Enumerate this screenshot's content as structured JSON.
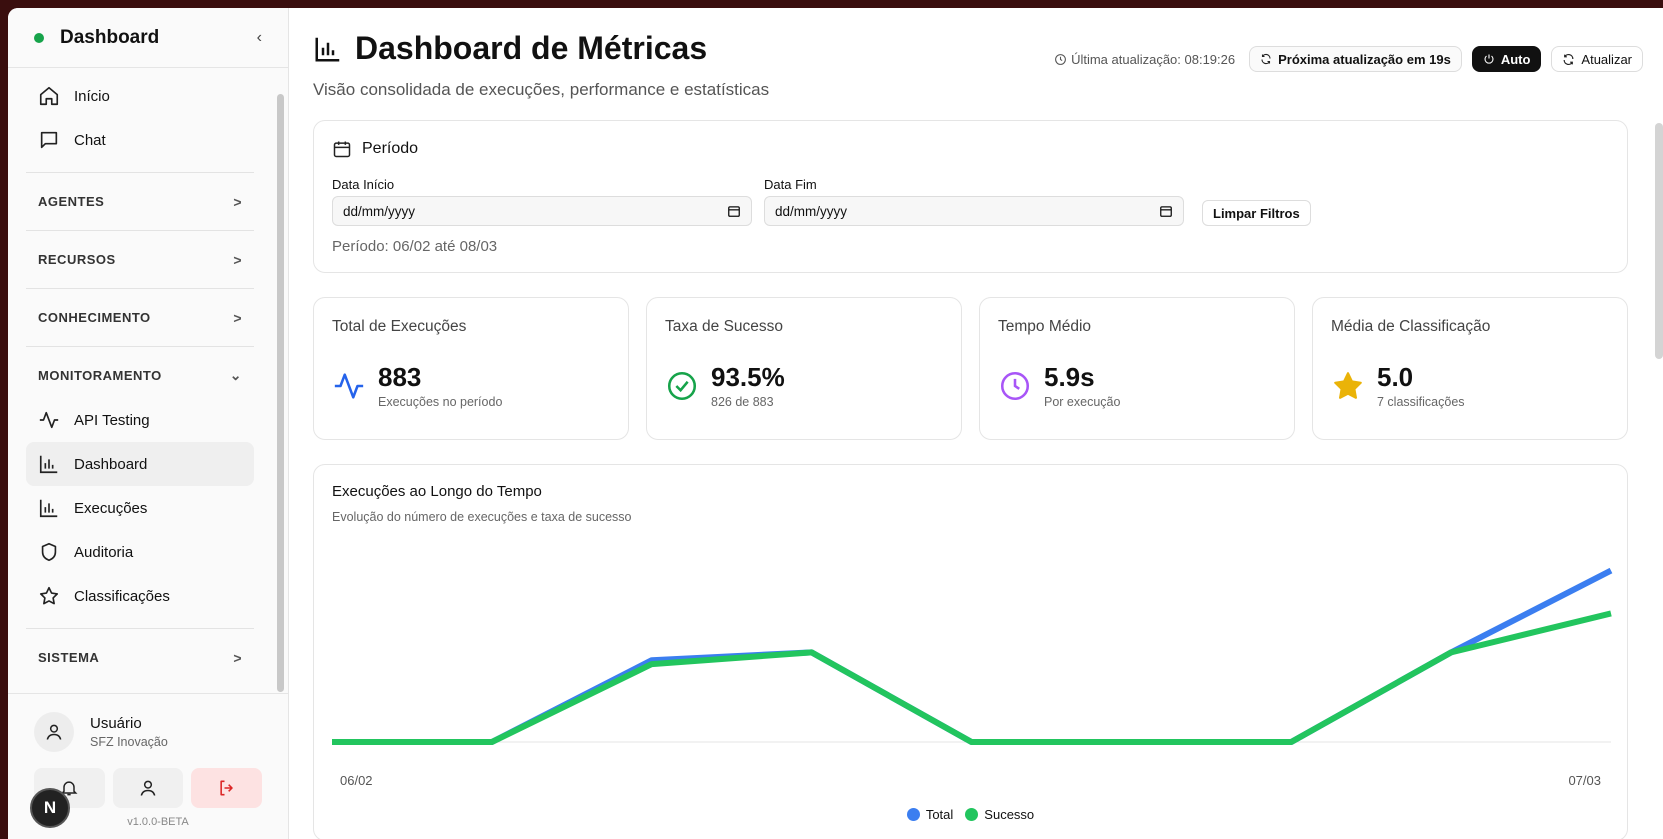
{
  "sidebar": {
    "title": "Dashboard",
    "collapse_icon": "‹",
    "top_items": [
      {
        "label": "Início",
        "icon": "home-icon"
      },
      {
        "label": "Chat",
        "icon": "chat-icon"
      }
    ],
    "sections": {
      "agentes": "AGENTES",
      "recursos": "RECURSOS",
      "conhecimento": "CONHECIMENTO",
      "monitoramento": "MONITORAMENTO",
      "sistema": "SISTEMA"
    },
    "monitor_items": [
      {
        "label": "API Testing",
        "icon": "activity-icon"
      },
      {
        "label": "Dashboard",
        "icon": "bar-chart-icon",
        "active": true
      },
      {
        "label": "Execuções",
        "icon": "bar-chart-icon"
      },
      {
        "label": "Auditoria",
        "icon": "shield-icon"
      },
      {
        "label": "Classificações",
        "icon": "star-icon"
      }
    ],
    "user": {
      "name": "Usuário",
      "org": "SFZ Inovação"
    },
    "version": "v1.0.0-BETA",
    "logo_letter": "N"
  },
  "header": {
    "title": "Dashboard de Métricas",
    "subtitle": "Visão consolidada de execuções, performance e estatísticas",
    "last_update": "Última atualização: 08:19:26",
    "next_update": "Próxima atualização em 19s",
    "auto_label": "Auto",
    "refresh_label": "Atualizar"
  },
  "period": {
    "title": "Período",
    "start_label": "Data Início",
    "start_placeholder": "dd/mm/yyyy",
    "end_label": "Data Fim",
    "end_placeholder": "dd/mm/yyyy",
    "clear_label": "Limpar Filtros",
    "range_text": "Período: 06/02 até 08/03"
  },
  "stats": [
    {
      "label": "Total de Execuções",
      "value": "883",
      "caption": "Execuções no período",
      "icon": "activity-icon",
      "color": "#2563eb"
    },
    {
      "label": "Taxa de Sucesso",
      "value": "93.5%",
      "caption": "826 de 883",
      "icon": "check-circle-icon",
      "color": "#16a34a"
    },
    {
      "label": "Tempo Médio",
      "value": "5.9s",
      "caption": "Por execução",
      "icon": "clock-icon",
      "color": "#a855f7"
    },
    {
      "label": "Média de Classificação",
      "value": "5.0",
      "caption": "7 classificações",
      "icon": "star-icon",
      "color": "#eab308"
    }
  ],
  "chart_data": {
    "type": "line",
    "title": "Execuções ao Longo do Tempo",
    "subtitle": "Evolução do número de execuções e taxa de sucesso",
    "x_tick_labels": [
      "06/02",
      "07/03"
    ],
    "series": [
      {
        "name": "Total",
        "color": "#3b7ef0",
        "values": [
          0,
          0,
          105,
          115,
          0,
          0,
          0,
          115,
          220
        ]
      },
      {
        "name": "Sucesso",
        "color": "#22c55e",
        "values": [
          0,
          0,
          100,
          115,
          0,
          0,
          0,
          115,
          165
        ]
      }
    ],
    "ylim": [
      0,
      240
    ],
    "grid": false,
    "legend_position": "bottom"
  }
}
